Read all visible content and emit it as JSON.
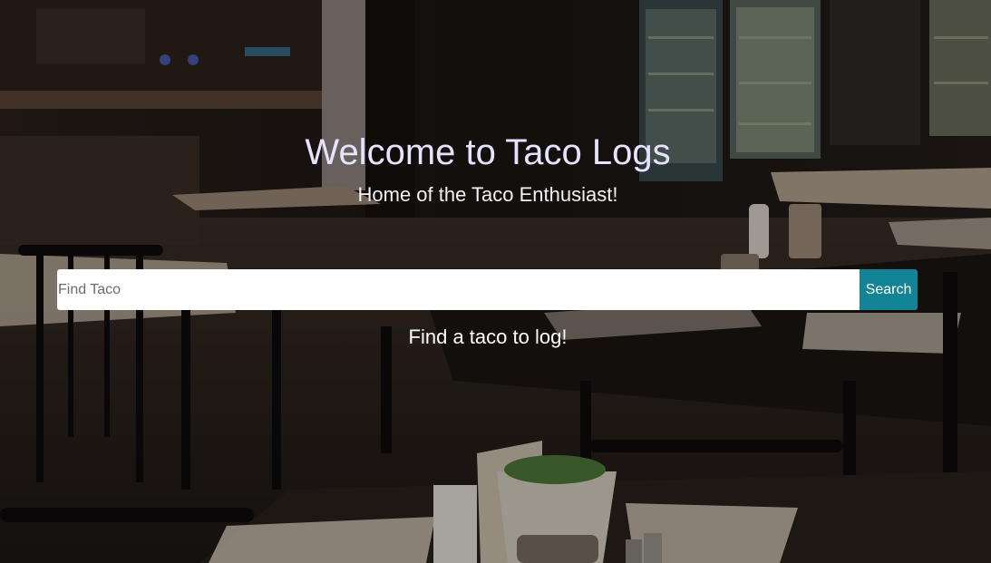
{
  "hero": {
    "title": "Welcome to Taco Logs",
    "subtitle": "Home of the Taco Enthusiast!",
    "hint": "Find a taco to log!"
  },
  "search": {
    "placeholder": "Find Taco",
    "value": "",
    "button_label": "Search"
  },
  "colors": {
    "accent": "#138496",
    "title": "#e6e3ff",
    "text": "#ffffff"
  }
}
